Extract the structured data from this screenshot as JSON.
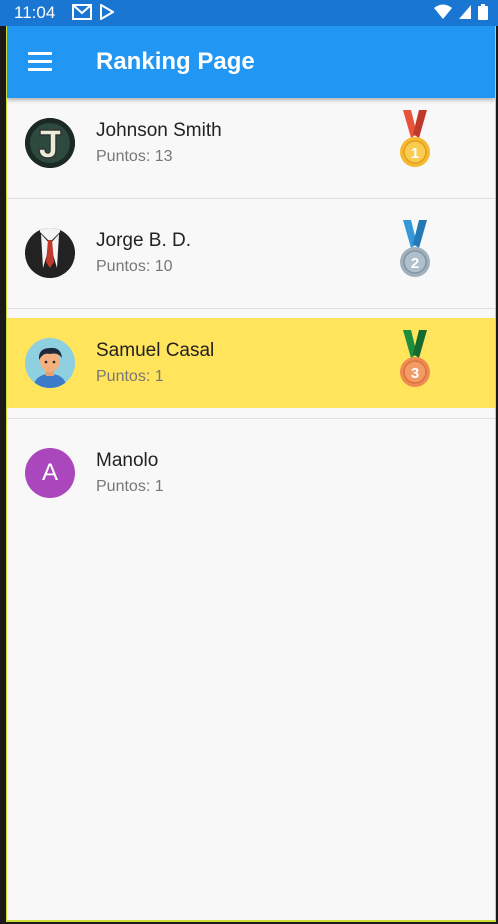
{
  "status": {
    "time": "11:04",
    "left_icons": [
      "gmail-icon",
      "play-store-icon"
    ],
    "right_icons": [
      "wifi-icon",
      "signal-icon",
      "battery-icon"
    ]
  },
  "app_bar": {
    "title": "Ranking Page",
    "menu_icon": "hamburger-menu-icon"
  },
  "ranking": [
    {
      "name": "Johnson Smith",
      "points": "Puntos: 13",
      "avatar": "letter-j-logo",
      "medal": "1",
      "medal_color": "#F5B82E",
      "ribbon_color": "#E8543B",
      "highlighted": false
    },
    {
      "name": "Jorge B. D.",
      "points": "Puntos: 10",
      "avatar": "suit-tie-avatar",
      "medal": "2",
      "medal_color": "#9FB0BC",
      "ribbon_color": "#3498DB",
      "highlighted": false
    },
    {
      "name": "Samuel Casal",
      "points": "Puntos: 1",
      "avatar": "cartoon-man-avatar",
      "medal": "3",
      "medal_color": "#F08A52",
      "ribbon_color": "#1E8E3E",
      "highlighted": true
    },
    {
      "name": "Manolo",
      "points": "Puntos: 1",
      "avatar_letter": "A",
      "medal": "",
      "highlighted": false
    }
  ],
  "colors": {
    "app_bar": "#2196F3",
    "status_bar": "#1976D2",
    "highlight": "#FFE45C",
    "avatar_letter_bg": "#AB47BC"
  }
}
